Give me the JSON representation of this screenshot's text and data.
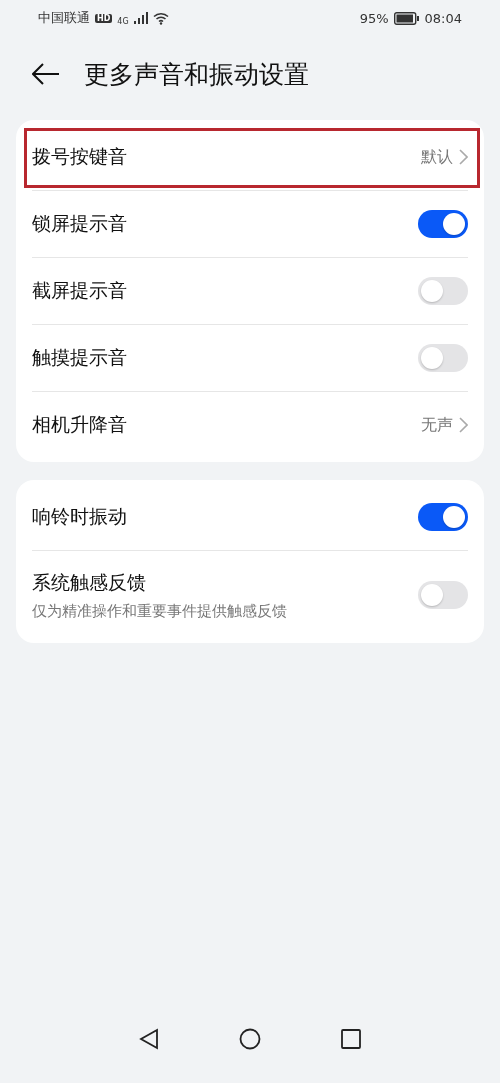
{
  "status_bar": {
    "carrier": "中国联通",
    "hd_badge": "HD",
    "network": "4G",
    "battery": "95%",
    "time": "08:04"
  },
  "header": {
    "title": "更多声音和振动设置"
  },
  "groups": [
    {
      "items": [
        {
          "kind": "link",
          "label": "拨号按键音",
          "value": "默认",
          "highlighted": true
        },
        {
          "kind": "switch",
          "label": "锁屏提示音",
          "on": true,
          "highlighted": false
        },
        {
          "kind": "switch",
          "label": "截屏提示音",
          "on": false,
          "highlighted": false
        },
        {
          "kind": "switch",
          "label": "触摸提示音",
          "on": false,
          "highlighted": false
        },
        {
          "kind": "link",
          "label": "相机升降音",
          "value": "无声",
          "highlighted": false
        }
      ]
    },
    {
      "items": [
        {
          "kind": "switch",
          "label": "响铃时振动",
          "on": true,
          "highlighted": false
        },
        {
          "kind": "switch",
          "label": "系统触感反馈",
          "subtitle": "仅为精准操作和重要事件提供触感反馈",
          "on": false,
          "highlighted": false
        }
      ]
    }
  ]
}
